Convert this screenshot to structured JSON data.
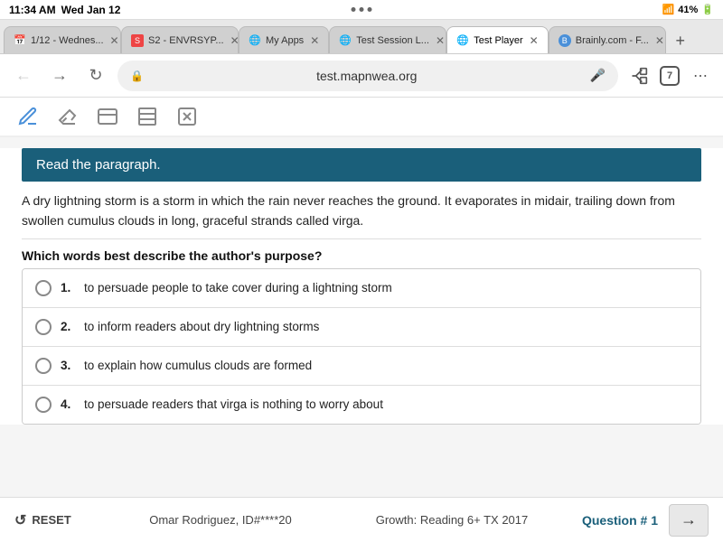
{
  "statusBar": {
    "time": "11:34 AM",
    "day": "Wed Jan 12",
    "signal": "WiFi",
    "battery": "41%"
  },
  "tabs": [
    {
      "id": "tab1",
      "label": "1/12 - Wednes...",
      "favicon": "📅",
      "active": false
    },
    {
      "id": "tab2",
      "label": "S2 - ENVRSYP...",
      "favicon": "🔵",
      "active": false
    },
    {
      "id": "tab3",
      "label": "My Apps",
      "favicon": "🌐",
      "active": false
    },
    {
      "id": "tab4",
      "label": "Test Session L...",
      "favicon": "🌐",
      "active": false
    },
    {
      "id": "tab5",
      "label": "Test Player",
      "favicon": "🌐",
      "active": true
    },
    {
      "id": "tab6",
      "label": "Brainly.com - F...",
      "favicon": "🧠",
      "active": false
    }
  ],
  "addressBar": {
    "url": "test.mapnwea.org",
    "secure": true
  },
  "toolbar": {
    "tools": [
      {
        "name": "pencil",
        "label": "✏️"
      },
      {
        "name": "eraser",
        "label": "⌫"
      },
      {
        "name": "highlight",
        "label": "▬"
      },
      {
        "name": "lines",
        "label": "≡"
      },
      {
        "name": "cross",
        "label": "✗"
      }
    ]
  },
  "question": {
    "header": "Read the paragraph.",
    "passage": "A dry lightning storm is a storm in which the rain never reaches the ground. It evaporates in midair, trailing down from swollen cumulus clouds in long, graceful strands called virga.",
    "questionText": "Which words best describe the author's purpose?",
    "options": [
      {
        "num": "1.",
        "text": "to persuade people to take cover during a lightning storm"
      },
      {
        "num": "2.",
        "text": "to inform readers about dry lightning storms"
      },
      {
        "num": "3.",
        "text": "to explain how cumulus clouds are formed"
      },
      {
        "num": "4.",
        "text": "to persuade readers that virga is nothing to worry about"
      }
    ]
  },
  "footer": {
    "resetLabel": "RESET",
    "studentInfo": "Omar Rodriguez, ID#****20",
    "growthInfo": "Growth: Reading 6+ TX 2017",
    "questionLabel": "Question # 1",
    "nextLabel": "→"
  }
}
